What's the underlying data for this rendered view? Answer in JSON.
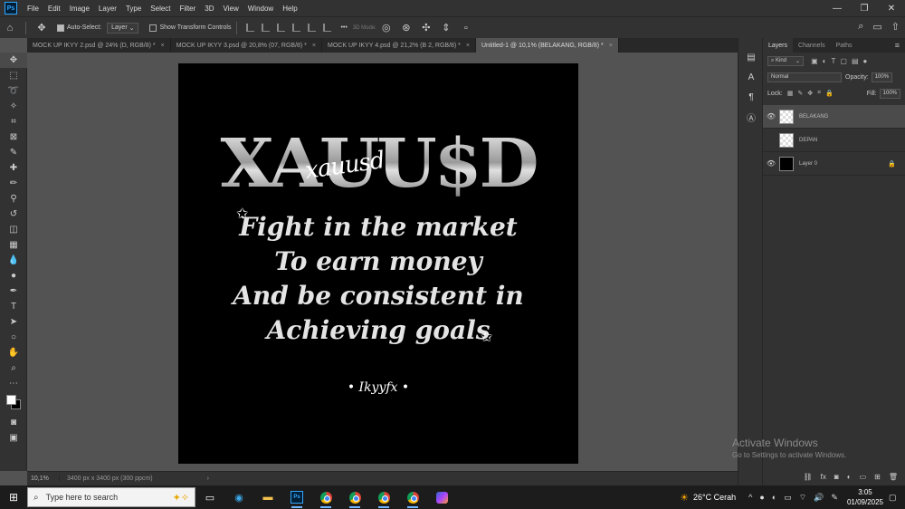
{
  "menubar": {
    "logo": "Ps",
    "items": [
      "File",
      "Edit",
      "Image",
      "Layer",
      "Type",
      "Select",
      "Filter",
      "3D",
      "View",
      "Window",
      "Help"
    ],
    "window_controls": [
      "—",
      "❐",
      "✕"
    ]
  },
  "options": {
    "auto_select_label": "Auto-Select:",
    "auto_select_value": "Layer",
    "transform_label": "Show Transform Controls",
    "mode_3d_label": "3D Mode:",
    "dots": "•••"
  },
  "tabs": [
    {
      "label": "MOCK UP IKYY 2.psd @ 24% (D, RGB/8) *",
      "active": false
    },
    {
      "label": "MOCK UP IKYY 3.psd @ 20,8% (07, RGB/8) *",
      "active": false
    },
    {
      "label": "MOCK UP IKYY 4.psd @ 21,2% (B 2, RGB/8) *",
      "active": false
    },
    {
      "label": "Untitled-1 @ 10,1% (BELAKANG, RGB/8) *",
      "active": true
    }
  ],
  "artwork": {
    "title": "XAUU$D",
    "script": "xauusd",
    "quote_lines": [
      "Fight in the market",
      "To earn money",
      "And be consistent in",
      "Achieving goals"
    ],
    "signature": "• Ikyyfx •"
  },
  "status": {
    "zoom": "10,1%",
    "doc": "3400 px x 3400 px (300 ppcm)",
    "arrow": "›"
  },
  "layers_panel": {
    "tabs": [
      "Layers",
      "Channels",
      "Paths"
    ],
    "kind_label": "Kind",
    "blend_mode": "Normal",
    "opacity_label": "Opacity:",
    "opacity_value": "100%",
    "lock_label": "Lock:",
    "fill_label": "Fill:",
    "fill_value": "100%",
    "layers": [
      {
        "name": "BELAKANG",
        "visible": true,
        "selected": true,
        "thumb": "checker",
        "locked": false
      },
      {
        "name": "DEPAN",
        "visible": false,
        "selected": false,
        "thumb": "checker",
        "locked": false
      },
      {
        "name": "Layer 0",
        "visible": true,
        "selected": false,
        "thumb": "black",
        "locked": true
      }
    ]
  },
  "watermark": {
    "title": "Activate Windows",
    "subtitle": "Go to Settings to activate Windows."
  },
  "taskbar": {
    "search_placeholder": "Type here to search",
    "weather": "26°C  Cerah",
    "time": "3:05",
    "date": "01/09/2025"
  }
}
